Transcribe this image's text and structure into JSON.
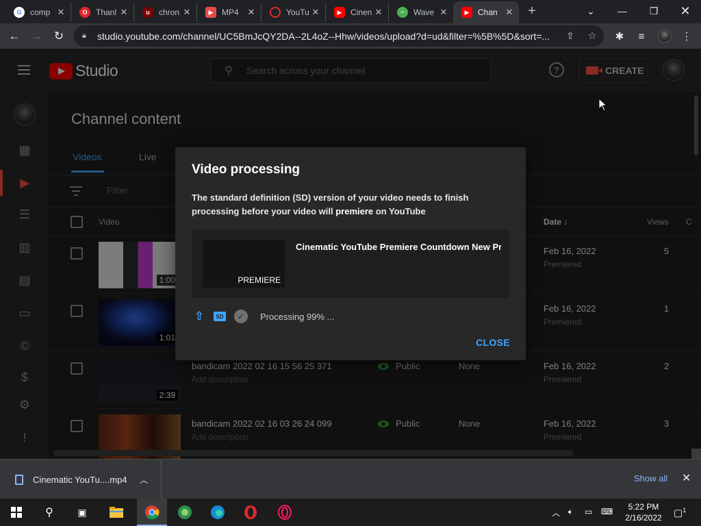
{
  "browser": {
    "tabs": [
      {
        "label": "comp",
        "icon": "google-icon",
        "color": "#ffffff"
      },
      {
        "label": "Thanl",
        "icon": "opera-icon",
        "color": "#e0272f"
      },
      {
        "label": "chron",
        "icon": "ublock-icon",
        "color": "#800000"
      },
      {
        "label": "MP4",
        "icon": "mp4-app-icon",
        "color": "#e24b4b"
      },
      {
        "label": "YouTu",
        "icon": "opera-o-icon",
        "color": "#e0272f"
      },
      {
        "label": "Cinen",
        "icon": "youtube-icon",
        "color": "#ff0000"
      },
      {
        "label": "Wave",
        "icon": "wave-icon",
        "color": "#4caf50"
      },
      {
        "label": "Chan",
        "icon": "youtube-icon",
        "color": "#ff0000"
      }
    ],
    "url": "studio.youtube.com/channel/UC5BmJcQY2DA--2L4oZ--Hhw/videos/upload?d=ud&filter=%5B%5D&sort=..."
  },
  "studio": {
    "logo_text": "Studio",
    "search_placeholder": "Search across your channel",
    "create_label": "CREATE"
  },
  "content": {
    "title": "Channel content",
    "tabs": [
      "Videos",
      "Live"
    ],
    "filter_placeholder": "Filter",
    "columns": {
      "video": "Video",
      "date": "Date",
      "views": "Views",
      "extra": "C"
    },
    "rows": [
      {
        "title": "",
        "desc": "",
        "visibility": "",
        "restrictions": "",
        "date": "Feb 16, 2022",
        "date_sub": "Premiered",
        "views": "5",
        "duration": "1:00"
      },
      {
        "title": "",
        "desc": "",
        "visibility": "",
        "restrictions": "",
        "date": "Feb 16, 2022",
        "date_sub": "Premiered",
        "views": "1",
        "duration": "1:01"
      },
      {
        "title": "bandicam 2022 02 16 15 56 25 371",
        "desc": "Add description",
        "visibility": "Public",
        "restrictions": "None",
        "date": "Feb 16, 2022",
        "date_sub": "Premiered",
        "views": "2",
        "duration": "2:39"
      },
      {
        "title": "bandicam 2022 02 16 03 26 24 099",
        "desc": "Add description",
        "visibility": "Public",
        "restrictions": "None",
        "date": "Feb 16, 2022",
        "date_sub": "Premiered",
        "views": "3",
        "duration": ""
      }
    ]
  },
  "dialog": {
    "title": "Video processing",
    "message_pre": "The standard definition (SD) version of your video needs to finish processing before your video will ",
    "message_bold": "premiere",
    "message_post": " on YouTube",
    "video_title": "Cinematic YouTube Premiere Countdown New Pr...",
    "badge": "PREMIERE",
    "sd_badge": "SD",
    "status": "Processing 99% ...",
    "close_label": "CLOSE"
  },
  "downloads": {
    "file": "Cinematic YouTu....mp4",
    "show_all": "Show all"
  },
  "taskbar": {
    "time": "5:22 PM",
    "date": "2/16/2022",
    "notifications": "1"
  }
}
